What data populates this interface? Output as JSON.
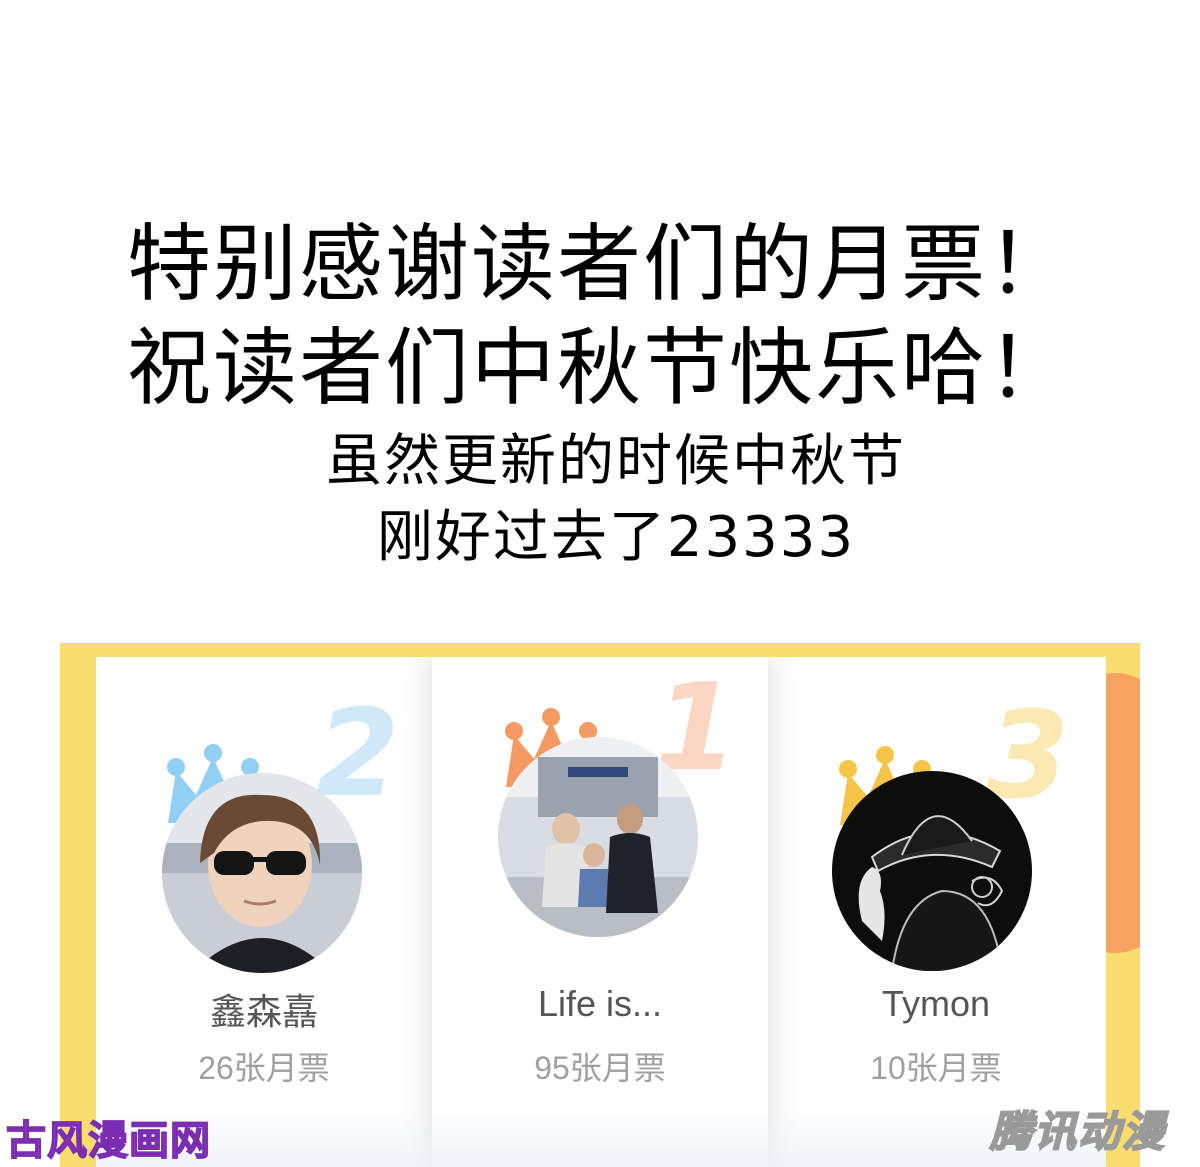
{
  "message": {
    "line1": "特别感谢读者们的月票！",
    "line2": "祝读者们中秋节快乐哈！",
    "line3": "虽然更新的时候中秋节",
    "line4": "刚好过去了23333"
  },
  "leaderboard": {
    "entries": [
      {
        "rank": "2",
        "name": "鑫森嚞",
        "votes": "26张月票",
        "crown_color": "#8fd0f4",
        "rank_color": "#cfe9f8"
      },
      {
        "rank": "1",
        "name": "Life is...",
        "votes": "95张月票",
        "crown_color": "#f59a62",
        "rank_color": "#fbd6c2"
      },
      {
        "rank": "3",
        "name": "Tymon",
        "votes": "10张月票",
        "crown_color": "#f6c548",
        "rank_color": "#fbe9b3"
      }
    ]
  },
  "watermarks": {
    "left": "古风漫画网",
    "right": "腾讯动漫"
  },
  "colors": {
    "frame": "#f9dd6e",
    "accent_orange": "#f8a35f"
  }
}
